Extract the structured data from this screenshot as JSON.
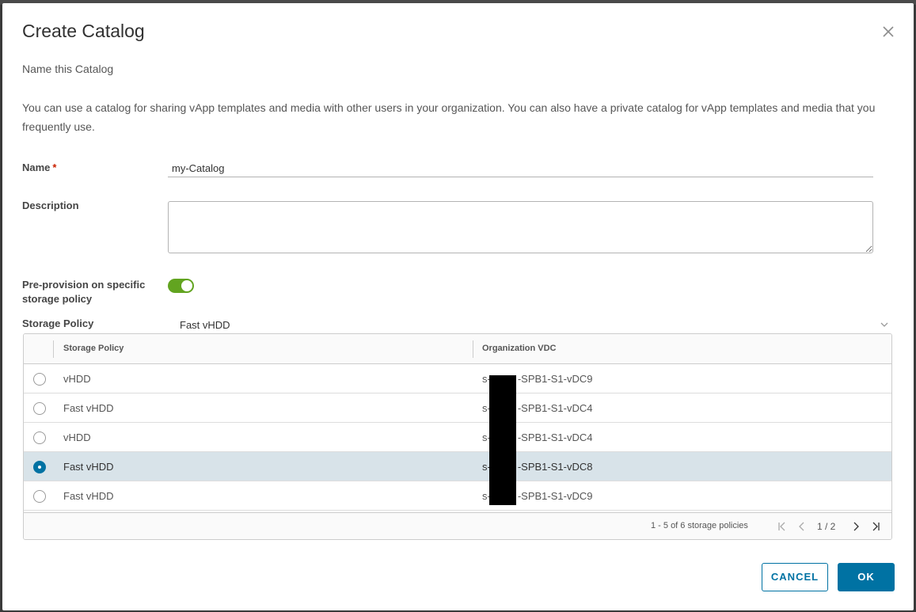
{
  "dialog": {
    "title": "Create Catalog",
    "subtitle": "Name this Catalog",
    "intro": "You can use a catalog for sharing vApp templates and media with other users in your organization. You can also have a private catalog for vApp templates and media that you frequently use.",
    "close_icon": "close-icon"
  },
  "form": {
    "name_label": "Name",
    "required_mark": "*",
    "name_value": "my-Catalog",
    "description_label": "Description",
    "description_value": "",
    "preprovision_label": "Pre-provision on specific storage policy",
    "preprovision_enabled": true,
    "storage_policy_label": "Storage Policy",
    "storage_policy_selected": "Fast vHDD"
  },
  "grid": {
    "columns": [
      "Storage Policy",
      "Organization VDC"
    ],
    "rows": [
      {
        "policy": "vHDD",
        "vdc_prefix": "s-",
        "vdc_suffix": "-SPB1-S1-vDC9",
        "selected": false
      },
      {
        "policy": "Fast vHDD",
        "vdc_prefix": "s-",
        "vdc_suffix": "-SPB1-S1-vDC4",
        "selected": false
      },
      {
        "policy": "vHDD",
        "vdc_prefix": "s-",
        "vdc_suffix": "-SPB1-S1-vDC4",
        "selected": false
      },
      {
        "policy": "Fast vHDD",
        "vdc_prefix": "s-",
        "vdc_suffix": "-SPB1-S1-vDC8",
        "selected": true
      },
      {
        "policy": "Fast vHDD",
        "vdc_prefix": "s-",
        "vdc_suffix": "-SPB1-S1-vDC9",
        "selected": false
      }
    ],
    "footer": {
      "summary": "1 - 5 of 6 storage policies",
      "page": "1 / 2"
    }
  },
  "actions": {
    "cancel": "CANCEL",
    "ok": "OK"
  },
  "colors": {
    "primary": "#0072a3",
    "toggle_on": "#62a420",
    "selected_row": "#d8e3e9",
    "required": "#c92100"
  }
}
